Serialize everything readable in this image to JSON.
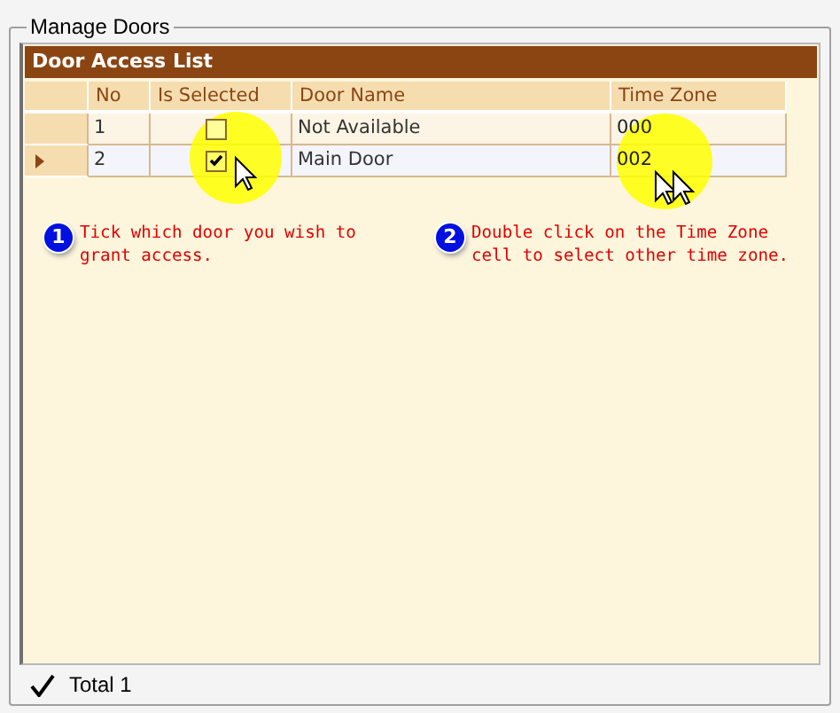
{
  "group": {
    "title": "Manage Doors"
  },
  "grid": {
    "title": "Door Access List",
    "columns": [
      "No",
      "Is Selected",
      "Door Name",
      "Time Zone"
    ],
    "rows": [
      {
        "no": "1",
        "checked": false,
        "door_name": "Not Available",
        "time_zone": "000",
        "selected": false
      },
      {
        "no": "2",
        "checked": true,
        "door_name": "Main Door",
        "time_zone": "002",
        "selected": true
      }
    ]
  },
  "hints": [
    {
      "number": "1",
      "text": "Tick which door you wish to grant access."
    },
    {
      "number": "2",
      "text": "Double click on the Time Zone cell to select other time zone."
    }
  ],
  "status": {
    "text": "Total 1"
  }
}
